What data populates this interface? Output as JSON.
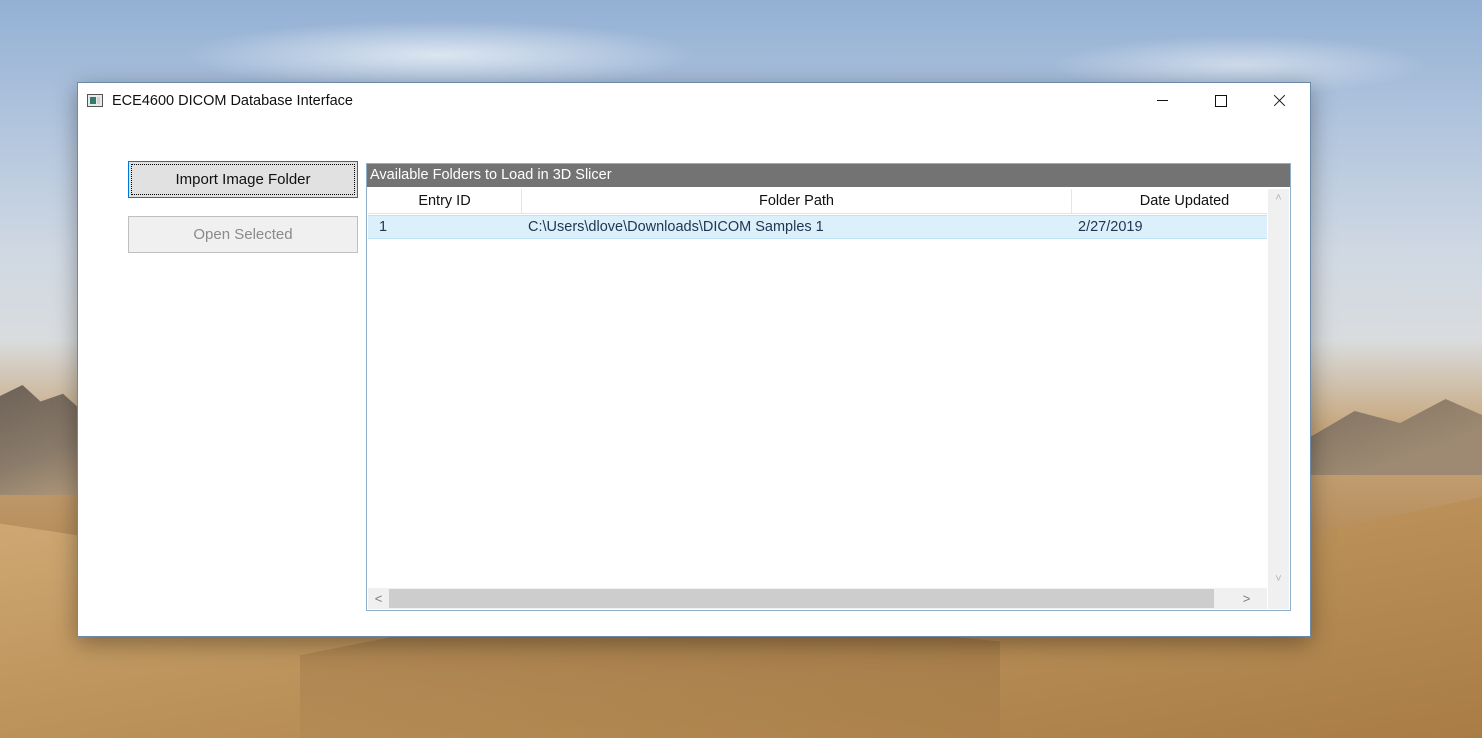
{
  "window": {
    "title": "ECE4600 DICOM Database Interface",
    "controls": {
      "minimize": "minimize-icon",
      "maximize": "maximize-icon",
      "close": "close-icon"
    }
  },
  "buttons": {
    "import_label": "Import Image Folder",
    "open_label": "Open Selected"
  },
  "panel": {
    "title": "Available Folders to Load in 3D Slicer",
    "columns": [
      "Entry ID",
      "Folder Path",
      "Date Updated"
    ],
    "rows": [
      {
        "id": "1",
        "path": "C:\\Users\\dlove\\Downloads\\DICOM Samples 1",
        "date": "2/27/2019"
      }
    ]
  },
  "scrollbars": {
    "up": "˄",
    "down": "˅",
    "left": "<",
    "right": ">"
  },
  "colors": {
    "panel_header_bg": "#737373",
    "selected_row_bg": "#dcf0fb",
    "focus_border": "#0078d7"
  }
}
